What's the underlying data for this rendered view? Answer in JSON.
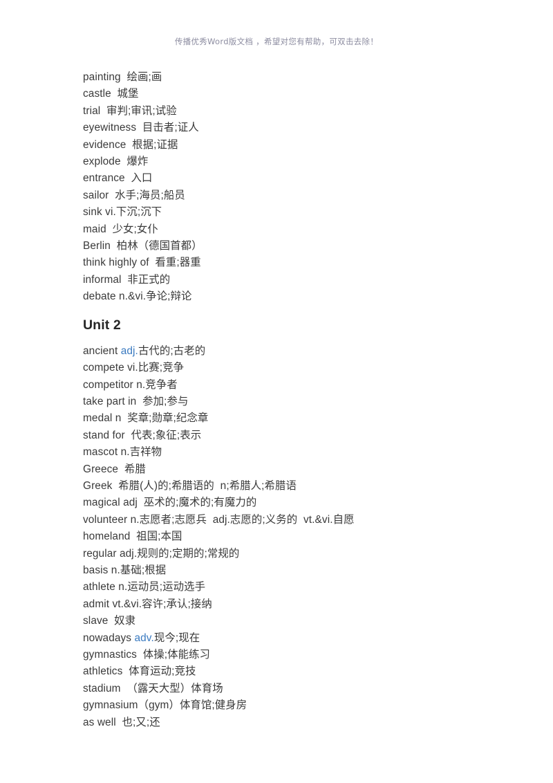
{
  "header": {
    "watermark": "传播优秀Word版文档 ，希望对您有帮助，可双击去除！"
  },
  "document": {
    "sections": [
      {
        "heading": null,
        "lines": [
          {
            "text": "painting  绘画;画"
          },
          {
            "text": "castle  城堡"
          },
          {
            "text": "trial  审判;审讯;试验"
          },
          {
            "text": "eyewitness  目击者;证人"
          },
          {
            "text": "evidence  根据;证据"
          },
          {
            "text": "explode  爆炸"
          },
          {
            "text": "entrance  入口"
          },
          {
            "text": "sailor  水手;海员;船员"
          },
          {
            "text": "sink vi.下沉;沉下"
          },
          {
            "text": "maid  少女;女仆"
          },
          {
            "text": "Berlin  柏林（德国首都）"
          },
          {
            "text": "think highly of  看重;器重"
          },
          {
            "text": "informal  非正式的"
          },
          {
            "text": "debate n.&vi.争论;辩论"
          }
        ]
      },
      {
        "heading": "Unit 2",
        "lines": [
          {
            "pre": "ancient ",
            "accent": "adj.",
            "post": "古代的;古老的"
          },
          {
            "text": "compete vi.比赛;竞争"
          },
          {
            "text": "competitor n.竞争者"
          },
          {
            "text": "take part in  参加;参与"
          },
          {
            "text": "medal n  奖章;勋章;纪念章"
          },
          {
            "text": "stand for  代表;象征;表示"
          },
          {
            "text": "mascot n.吉祥物"
          },
          {
            "text": "Greece  希腊"
          },
          {
            "text": "Greek  希腊(人)的;希腊语的  n;希腊人;希腊语"
          },
          {
            "text": "magical adj  巫术的;魔术的;有魔力的"
          },
          {
            "text": "volunteer n.志愿者;志愿兵  adj.志愿的;义务的  vt.&vi.自愿"
          },
          {
            "text": "homeland  祖国;本国"
          },
          {
            "text": "regular adj.规则的;定期的;常规的"
          },
          {
            "text": "basis n.基础;根据"
          },
          {
            "text": "athlete n.运动员;运动选手"
          },
          {
            "text": "admit vt.&vi.容许;承认;接纳"
          },
          {
            "text": "slave  奴隶"
          },
          {
            "pre": "nowadays ",
            "accent": "adv.",
            "post": "现今;现在"
          },
          {
            "text": "gymnastics  体操;体能练习"
          },
          {
            "text": "athletics  体育运动;竞技"
          },
          {
            "text": "stadium  （露天大型）体育场"
          },
          {
            "text": "gymnasium（gym）体育馆;健身房"
          },
          {
            "text": "as well  也;又;还"
          }
        ]
      }
    ]
  },
  "colors": {
    "text": "#3a3a3a",
    "heading": "#262626",
    "accent": "#3a7ac0",
    "watermark": "#8c8ca0",
    "background": "#ffffff"
  }
}
